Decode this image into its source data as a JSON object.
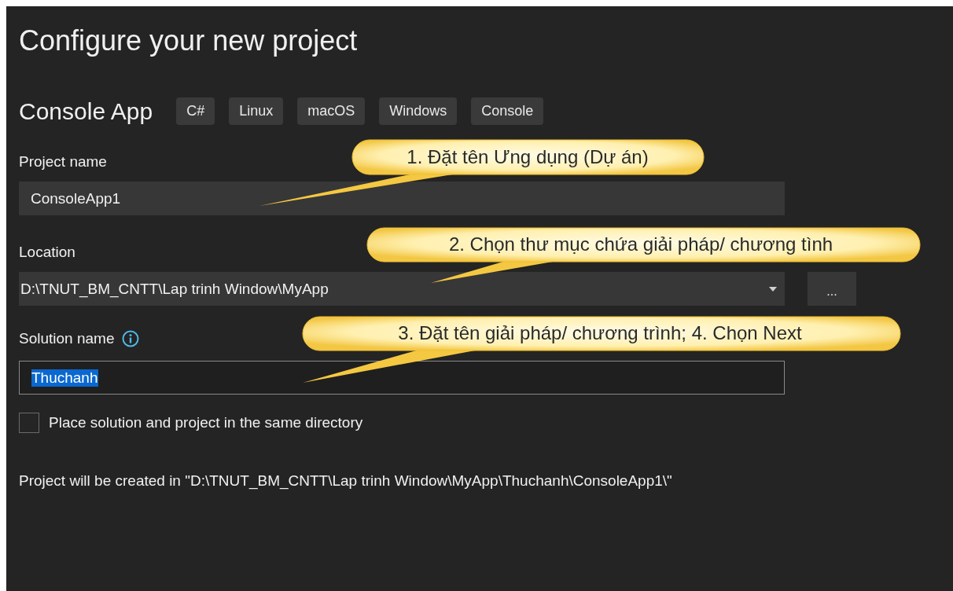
{
  "title": "Configure your new project",
  "template": {
    "name": "Console App",
    "tags": [
      "C#",
      "Linux",
      "macOS",
      "Windows",
      "Console"
    ]
  },
  "project_name": {
    "label": "Project name",
    "value": "ConsoleApp1"
  },
  "location": {
    "label": "Location",
    "value": "D:\\TNUT_BM_CNTT\\Lap trinh Window\\MyApp",
    "browse_button": "..."
  },
  "solution_name": {
    "label": "Solution name",
    "value": "Thuchanh",
    "value_selected": true
  },
  "same_directory": {
    "label": "Place solution and project in the same directory",
    "checked": false
  },
  "created_in": "Project will be created in \"D:\\TNUT_BM_CNTT\\Lap trinh Window\\MyApp\\Thuchanh\\ConsoleApp1\\\"",
  "callouts": [
    "1. Đặt tên Ưng dụng (Dự án)",
    "2. Chọn thư mục chứa giải pháp/ chương tình",
    "3. Đặt tên giải pháp/ chương trình; 4. Chọn Next"
  ]
}
